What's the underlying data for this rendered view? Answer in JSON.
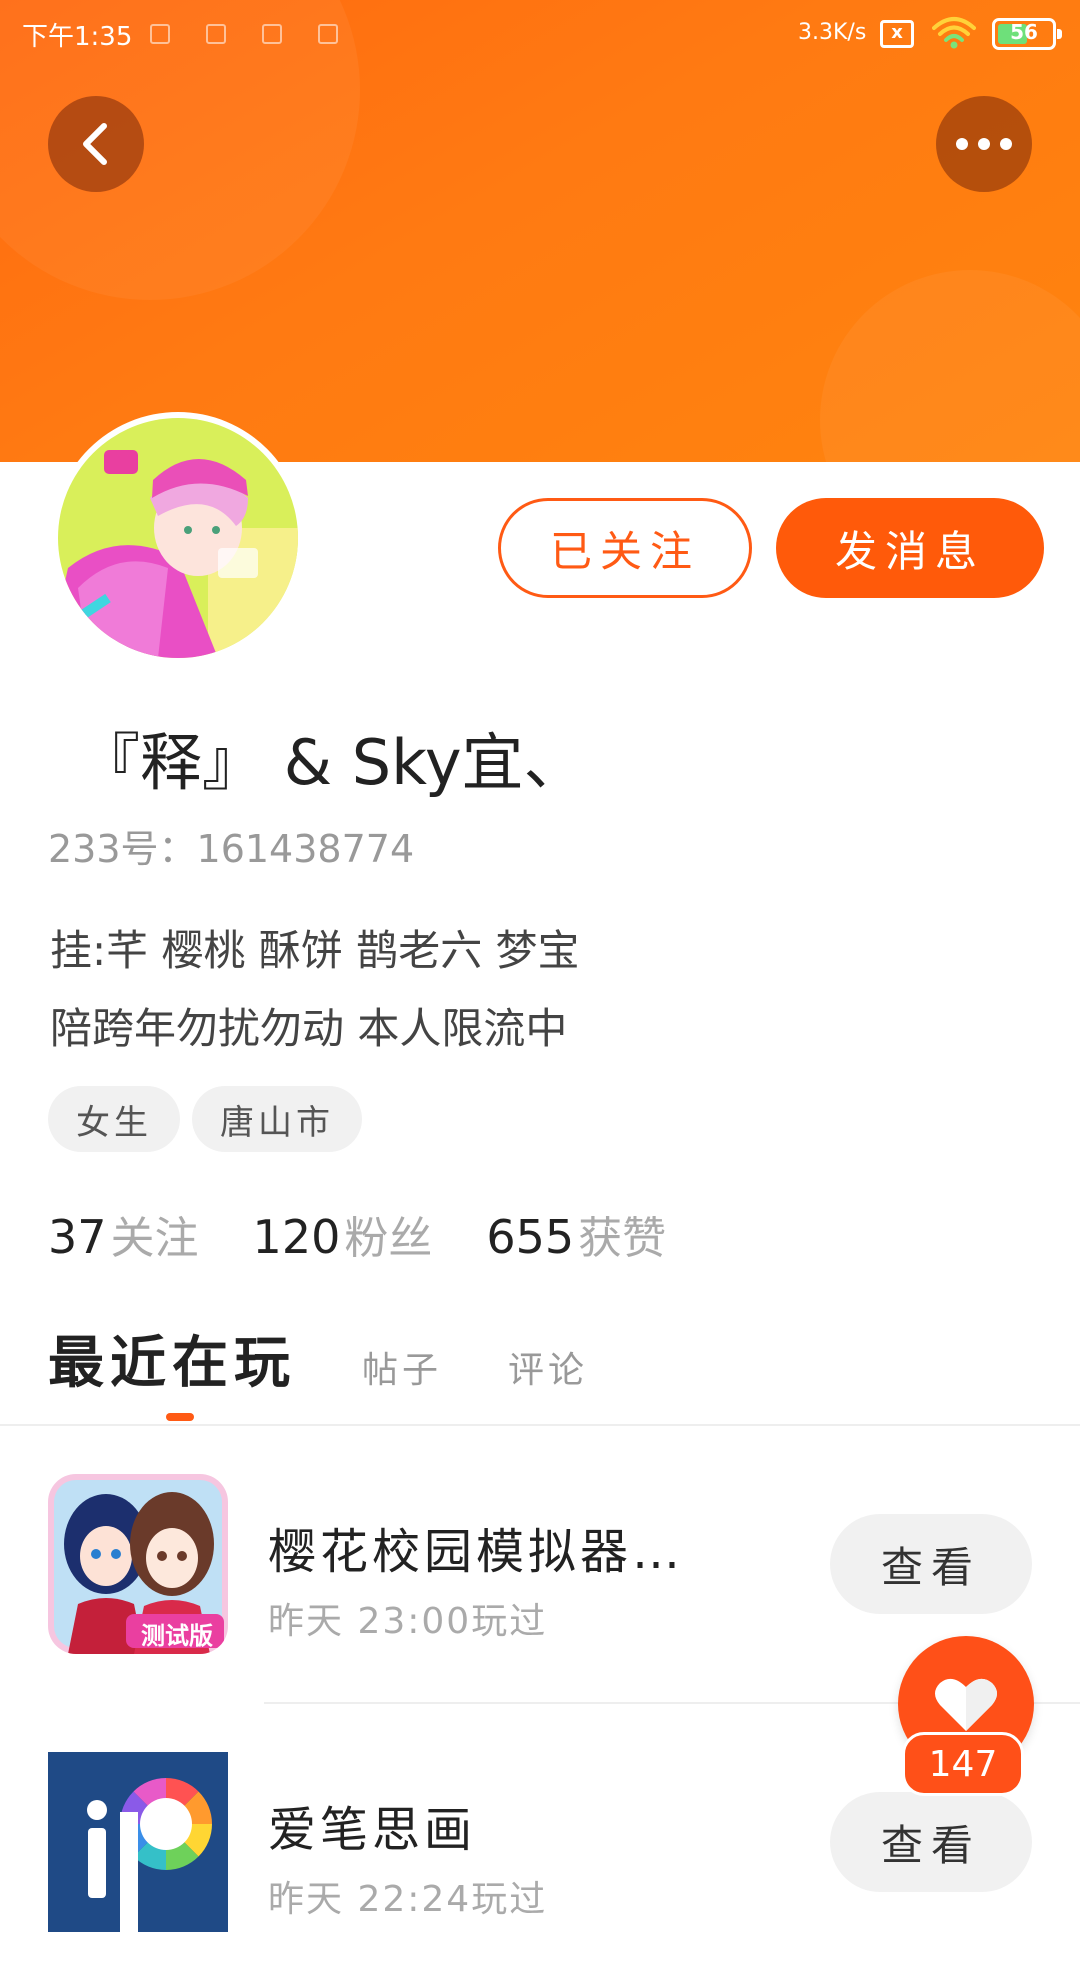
{
  "status_bar": {
    "time": "下午1:35",
    "net_speed": "3.3K/s",
    "sim_icon": "x",
    "battery_level": "56",
    "battery_fraction": 0.56
  },
  "colors": {
    "accent": "#ff5a0a",
    "header": "#ff7a12",
    "muted": "#aaaaaa"
  },
  "header": {
    "back_icon": "chevron-left-icon",
    "more_icon": "ellipsis-icon"
  },
  "profile": {
    "follow_label": "已关注",
    "message_label": "发消息",
    "username": "『释』 & Sky宜、",
    "id_text": "233号：161438774",
    "bio_lines": [
      "挂:芊 樱桃 酥饼 鹊老六 梦宝",
      "陪跨年勿扰勿动 本人限流中"
    ],
    "tags": [
      "女生",
      "唐山市"
    ]
  },
  "stats": [
    {
      "num": "37",
      "label": "关注"
    },
    {
      "num": "120",
      "label": "粉丝"
    },
    {
      "num": "655",
      "label": "获赞"
    }
  ],
  "tabs": {
    "active": "最近在玩",
    "items": [
      "帖子",
      "评论"
    ]
  },
  "games": [
    {
      "title": "樱花校园模拟器…",
      "time": "昨天 23:00玩过",
      "button": "查看",
      "icon_badge": "测试版"
    },
    {
      "title": "爱笔思画",
      "time": "昨天 22:24玩过",
      "button": "查看"
    }
  ],
  "like": {
    "count": "147"
  }
}
